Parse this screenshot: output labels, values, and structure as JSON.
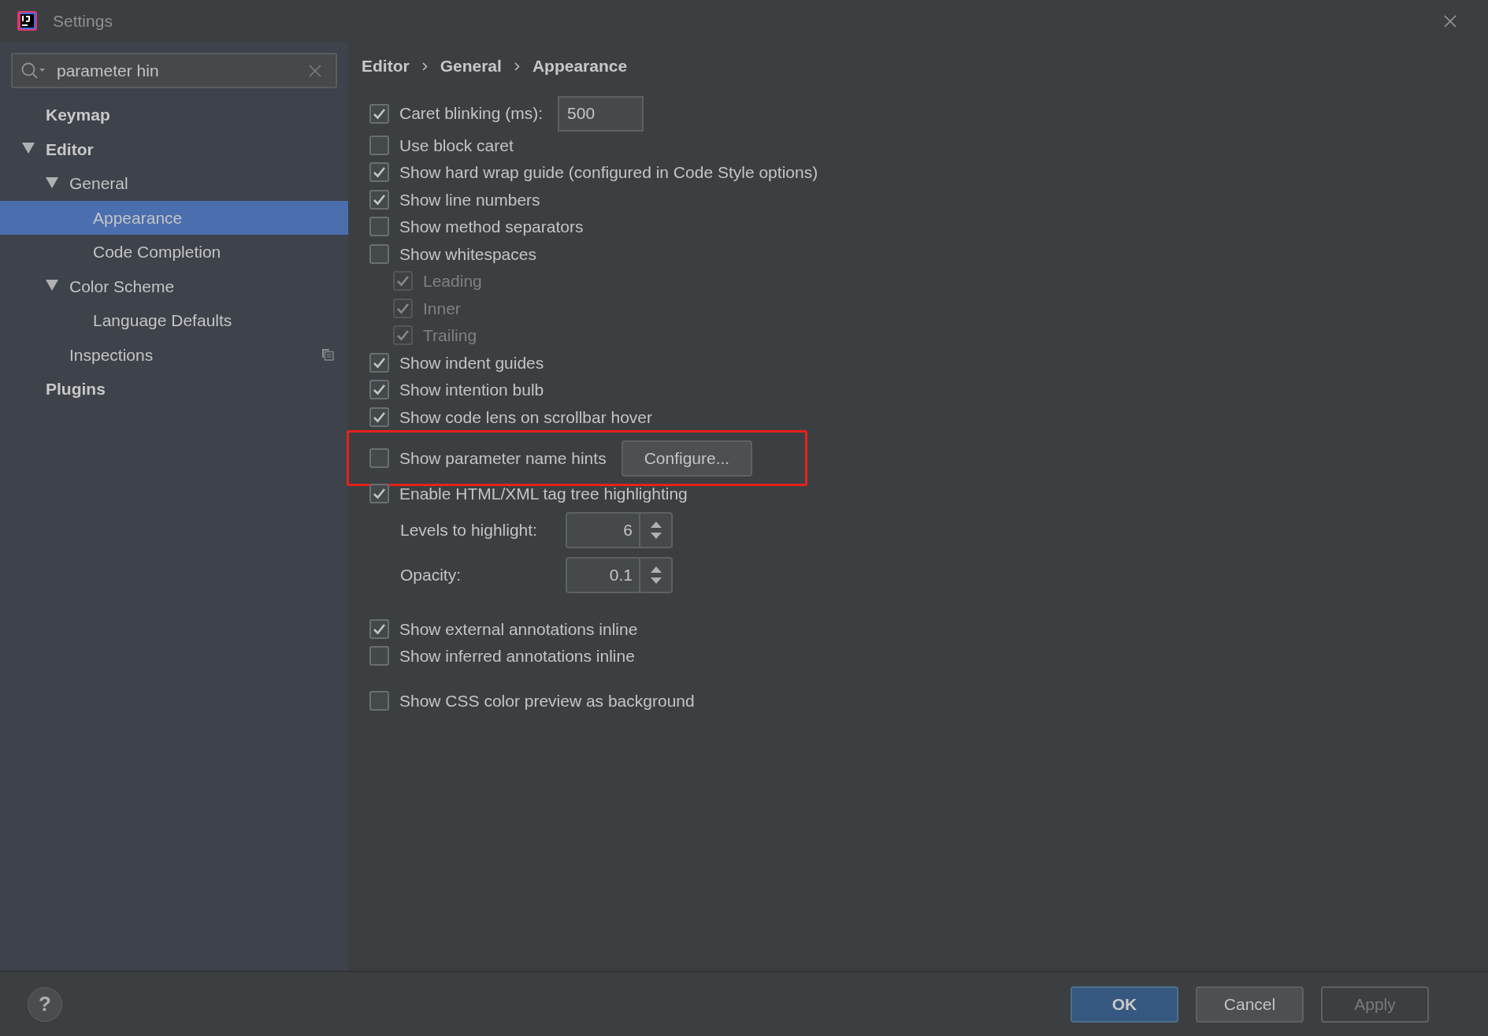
{
  "window": {
    "title": "Settings"
  },
  "search": {
    "value": "parameter hin"
  },
  "tree": [
    {
      "label": "Keymap",
      "selected": false,
      "has_icon": false
    },
    {
      "label": "Editor",
      "selected": false,
      "has_icon": false,
      "expanded": true,
      "children": [
        {
          "label": "General",
          "selected": false,
          "has_icon": false,
          "expanded": true,
          "children": [
            {
              "label": "Appearance",
              "selected": true,
              "has_icon": false
            },
            {
              "label": "Code Completion",
              "selected": false,
              "has_icon": false
            }
          ]
        },
        {
          "label": "Color Scheme",
          "selected": false,
          "has_icon": false,
          "expanded": true,
          "children": [
            {
              "label": "Language Defaults",
              "selected": false,
              "has_icon": false
            }
          ]
        },
        {
          "label": "Inspections",
          "selected": false,
          "has_icon": true
        }
      ]
    },
    {
      "label": "Plugins",
      "selected": false,
      "has_icon": false
    }
  ],
  "breadcrumb": [
    "Editor",
    "General",
    "Appearance"
  ],
  "sections": [
    {
      "items": [
        {
          "kind": "checkbox",
          "label": "Caret blinking (ms):",
          "checked": true,
          "disabled": false,
          "highlighted": false,
          "value": "500"
        },
        {
          "kind": "checkbox",
          "label": "Use block caret",
          "checked": false,
          "disabled": false,
          "highlighted": false
        },
        {
          "kind": "checkbox",
          "label": "Show hard wrap guide (configured in Code Style options)",
          "checked": true,
          "disabled": false,
          "highlighted": false
        },
        {
          "kind": "checkbox",
          "label": "Show line numbers",
          "checked": true,
          "disabled": false,
          "highlighted": false
        },
        {
          "kind": "checkbox",
          "label": "Show method separators",
          "checked": false,
          "disabled": false,
          "highlighted": false
        },
        {
          "kind": "checkbox",
          "label": "Show whitespaces",
          "checked": false,
          "disabled": false,
          "highlighted": false,
          "children": [
            {
              "kind": "checkbox",
              "label": "Leading",
              "checked": true,
              "disabled": true,
              "highlighted": false
            },
            {
              "kind": "checkbox",
              "label": "Inner",
              "checked": true,
              "disabled": true,
              "highlighted": false
            },
            {
              "kind": "checkbox",
              "label": "Trailing",
              "checked": true,
              "disabled": true,
              "highlighted": false
            }
          ]
        },
        {
          "kind": "checkbox",
          "label": "Show indent guides",
          "checked": true,
          "disabled": false,
          "highlighted": false
        },
        {
          "kind": "checkbox",
          "label": "Show intention bulb",
          "checked": true,
          "disabled": false,
          "highlighted": false
        },
        {
          "kind": "checkbox",
          "label": "Show code lens on scrollbar hover",
          "checked": true,
          "disabled": false,
          "highlighted": false
        },
        {
          "kind": "checkbox",
          "label": "Show parameter name hints",
          "checked": false,
          "disabled": false,
          "highlighted": true,
          "button": "Configure..."
        },
        {
          "kind": "checkbox",
          "label": "Enable HTML/XML tag tree highlighting",
          "checked": true,
          "disabled": false,
          "highlighted": false,
          "children": [
            {
              "kind": "number",
              "label": "Levels to highlight:",
              "value": "6"
            },
            {
              "kind": "number",
              "label": "Opacity:",
              "value": "0.1"
            }
          ]
        }
      ]
    },
    {
      "items": [
        {
          "kind": "checkbox",
          "label": "Show external annotations inline",
          "checked": true,
          "disabled": false,
          "highlighted": false
        },
        {
          "kind": "checkbox",
          "label": "Show inferred annotations inline",
          "checked": false,
          "disabled": false,
          "highlighted": false
        }
      ]
    },
    {
      "items": [
        {
          "kind": "checkbox",
          "label": "Show CSS color preview as background",
          "checked": false,
          "disabled": false,
          "highlighted": false
        }
      ]
    }
  ],
  "help": "?",
  "buttons": [
    {
      "label": "OK",
      "default": true,
      "disabled": false
    },
    {
      "label": "Cancel",
      "default": false,
      "disabled": false
    },
    {
      "label": "Apply",
      "default": false,
      "disabled": true
    }
  ]
}
